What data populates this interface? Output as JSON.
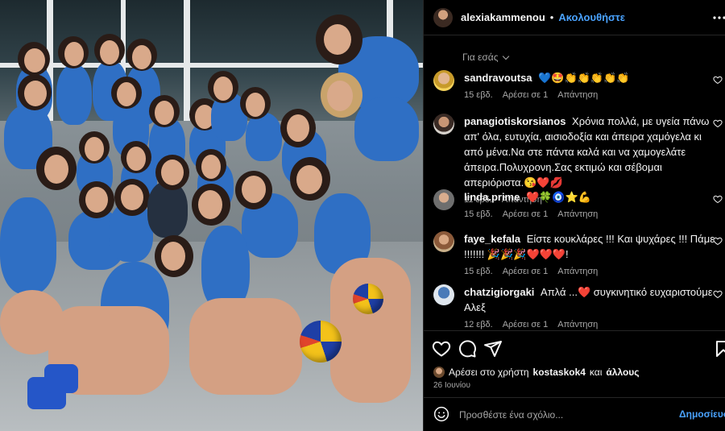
{
  "photo": {
    "alt_icon": "greek-team-photo"
  },
  "header": {
    "username": "alexiakammenou",
    "separator": "•",
    "follow_label": "Ακολουθήστε",
    "more_icon": "more-horizontal-icon"
  },
  "comments_section": {
    "filter_label": "Για εσάς",
    "items": [
      {
        "username": "sandravoutsa",
        "text": "💙🤩👏👏👏👏👏",
        "time": "15 εβδ.",
        "likes": "Αρέσει σε 1",
        "reply": "Απάντηση"
      },
      {
        "username": "panagiotiskorsianos",
        "text": "Χρόνια πολλά, με υγεία πάνω απ' όλα, ευτυχία, αισιοδοξία και άπειρα χαμόγελα κι από μένα.Να στε πάντα καλά και να χαμογελάτε άπειρα.Πολυχρονη.Σας εκτιμώ και σέβομαι απεριόριστα.😘❤️💋",
        "time": "11 εβδ.",
        "likes": "",
        "reply": "Απάντηση"
      },
      {
        "username": "linda.prime",
        "text": "❤️🍀🧿⭐💪",
        "time": "15 εβδ.",
        "likes": "Αρέσει σε 1",
        "reply": "Απάντηση"
      },
      {
        "username": "faye_kefala",
        "text": "Είστε κουκλάρες !!! Και ψυχάρες !!! Πάμε !!!!!!! 🎉🎉🎉❤️❤️❤️!",
        "time": "15 εβδ.",
        "likes": "Αρέσει σε 1",
        "reply": "Απάντηση"
      },
      {
        "username": "chatzigiorgaki",
        "text": "Απλά ...❤️ συγκινητικό ευχαριστούμε Αλεξ",
        "time": "12 εβδ.",
        "likes": "Αρέσει σε 1",
        "reply": "Απάντηση"
      }
    ]
  },
  "actions": {
    "like_icon": "heart-icon",
    "comment_icon": "comment-icon",
    "share_icon": "send-icon",
    "save_icon": "bookmark-icon",
    "liked_by_prefix": "Αρέσει στο χρήστη",
    "liked_by_user": "kostaskok4",
    "liked_by_joiner": "και",
    "liked_by_others": "άλλους",
    "date": "26 Ιουνίου"
  },
  "add_comment": {
    "emoji_icon": "smile-icon",
    "placeholder": "Προσθέστε ένα σχόλιο...",
    "post_label": "Δημοσίευση"
  },
  "colors": {
    "accent": "#4aa3ff",
    "background": "#000000",
    "secondary_text": "#a8a8a8",
    "divider": "#262626",
    "jersey_blue": "#2f6fc4"
  }
}
